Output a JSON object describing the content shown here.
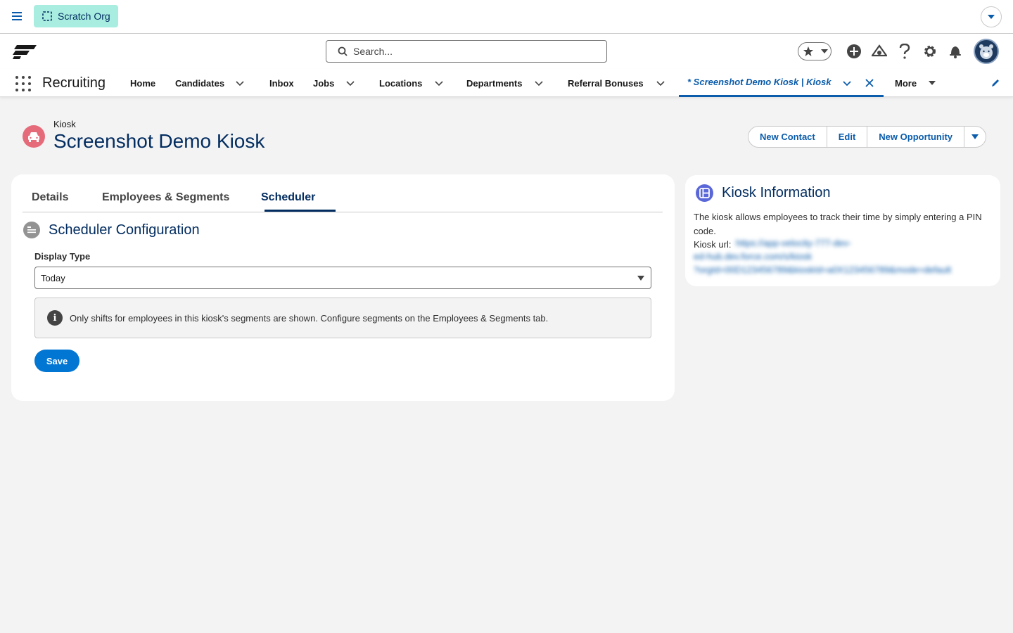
{
  "topbar": {
    "org_label": "Scratch Org"
  },
  "header": {
    "search_placeholder": "Search..."
  },
  "nav": {
    "app_name": "Recruiting",
    "items": [
      {
        "label": "Home",
        "has_menu": false
      },
      {
        "label": "Candidates",
        "has_menu": true
      },
      {
        "label": "Inbox",
        "has_menu": false
      },
      {
        "label": "Jobs",
        "has_menu": true
      },
      {
        "label": "Locations",
        "has_menu": true
      },
      {
        "label": "Departments",
        "has_menu": true
      },
      {
        "label": "Referral Bonuses",
        "has_menu": true
      }
    ],
    "active_tab": "* Screenshot Demo Kiosk | Kiosk",
    "more_label": "More"
  },
  "record": {
    "type": "Kiosk",
    "title": "Screenshot Demo Kiosk",
    "actions": [
      "New Contact",
      "Edit",
      "New Opportunity"
    ]
  },
  "tabs": [
    "Details",
    "Employees & Segments",
    "Scheduler"
  ],
  "active_tab_index": 2,
  "scheduler": {
    "section_title": "Scheduler Configuration",
    "display_type_label": "Display Type",
    "display_type_value": "Today",
    "notice": "Only shifts for employees in this kiosk's segments are shown. Configure segments on the Employees & Segments tab.",
    "save_label": "Save"
  },
  "kiosk_info": {
    "title": "Kiosk Information",
    "description": "The kiosk allows employees to track their time by simply entering a PIN code.",
    "url_label": "Kiosk url:",
    "url_lines": [
      "https://app-velocity-777-dev-",
      "ed-hub.dev.force.com/s/kiosk",
      "?orgId=00D123456789&kioskId=a0X123456789&mode=default"
    ]
  },
  "colors": {
    "brand_blue": "#0176d3",
    "link_blue": "#0b5cab",
    "navy": "#032d60",
    "scratch_org_bg": "#a8ede0",
    "record_icon": "#e66b7a",
    "side_icon": "#5a67d8"
  }
}
